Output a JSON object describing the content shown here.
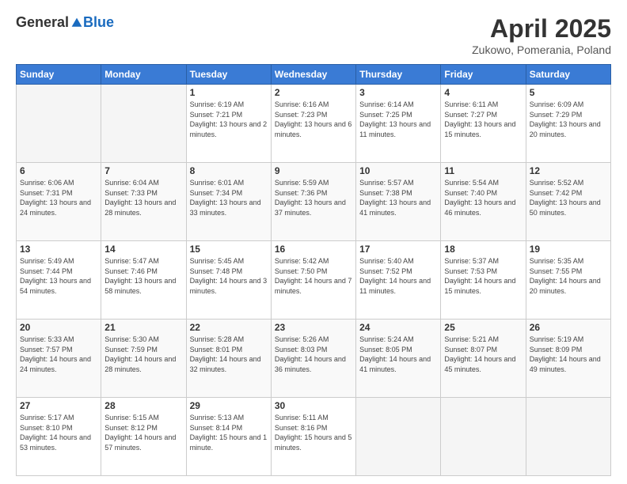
{
  "header": {
    "logo_general": "General",
    "logo_blue": "Blue",
    "month_title": "April 2025",
    "location": "Zukowo, Pomerania, Poland"
  },
  "days_of_week": [
    "Sunday",
    "Monday",
    "Tuesday",
    "Wednesday",
    "Thursday",
    "Friday",
    "Saturday"
  ],
  "weeks": [
    [
      {
        "day": "",
        "info": ""
      },
      {
        "day": "",
        "info": ""
      },
      {
        "day": "1",
        "info": "Sunrise: 6:19 AM\nSunset: 7:21 PM\nDaylight: 13 hours and 2 minutes."
      },
      {
        "day": "2",
        "info": "Sunrise: 6:16 AM\nSunset: 7:23 PM\nDaylight: 13 hours and 6 minutes."
      },
      {
        "day": "3",
        "info": "Sunrise: 6:14 AM\nSunset: 7:25 PM\nDaylight: 13 hours and 11 minutes."
      },
      {
        "day": "4",
        "info": "Sunrise: 6:11 AM\nSunset: 7:27 PM\nDaylight: 13 hours and 15 minutes."
      },
      {
        "day": "5",
        "info": "Sunrise: 6:09 AM\nSunset: 7:29 PM\nDaylight: 13 hours and 20 minutes."
      }
    ],
    [
      {
        "day": "6",
        "info": "Sunrise: 6:06 AM\nSunset: 7:31 PM\nDaylight: 13 hours and 24 minutes."
      },
      {
        "day": "7",
        "info": "Sunrise: 6:04 AM\nSunset: 7:33 PM\nDaylight: 13 hours and 28 minutes."
      },
      {
        "day": "8",
        "info": "Sunrise: 6:01 AM\nSunset: 7:34 PM\nDaylight: 13 hours and 33 minutes."
      },
      {
        "day": "9",
        "info": "Sunrise: 5:59 AM\nSunset: 7:36 PM\nDaylight: 13 hours and 37 minutes."
      },
      {
        "day": "10",
        "info": "Sunrise: 5:57 AM\nSunset: 7:38 PM\nDaylight: 13 hours and 41 minutes."
      },
      {
        "day": "11",
        "info": "Sunrise: 5:54 AM\nSunset: 7:40 PM\nDaylight: 13 hours and 46 minutes."
      },
      {
        "day": "12",
        "info": "Sunrise: 5:52 AM\nSunset: 7:42 PM\nDaylight: 13 hours and 50 minutes."
      }
    ],
    [
      {
        "day": "13",
        "info": "Sunrise: 5:49 AM\nSunset: 7:44 PM\nDaylight: 13 hours and 54 minutes."
      },
      {
        "day": "14",
        "info": "Sunrise: 5:47 AM\nSunset: 7:46 PM\nDaylight: 13 hours and 58 minutes."
      },
      {
        "day": "15",
        "info": "Sunrise: 5:45 AM\nSunset: 7:48 PM\nDaylight: 14 hours and 3 minutes."
      },
      {
        "day": "16",
        "info": "Sunrise: 5:42 AM\nSunset: 7:50 PM\nDaylight: 14 hours and 7 minutes."
      },
      {
        "day": "17",
        "info": "Sunrise: 5:40 AM\nSunset: 7:52 PM\nDaylight: 14 hours and 11 minutes."
      },
      {
        "day": "18",
        "info": "Sunrise: 5:37 AM\nSunset: 7:53 PM\nDaylight: 14 hours and 15 minutes."
      },
      {
        "day": "19",
        "info": "Sunrise: 5:35 AM\nSunset: 7:55 PM\nDaylight: 14 hours and 20 minutes."
      }
    ],
    [
      {
        "day": "20",
        "info": "Sunrise: 5:33 AM\nSunset: 7:57 PM\nDaylight: 14 hours and 24 minutes."
      },
      {
        "day": "21",
        "info": "Sunrise: 5:30 AM\nSunset: 7:59 PM\nDaylight: 14 hours and 28 minutes."
      },
      {
        "day": "22",
        "info": "Sunrise: 5:28 AM\nSunset: 8:01 PM\nDaylight: 14 hours and 32 minutes."
      },
      {
        "day": "23",
        "info": "Sunrise: 5:26 AM\nSunset: 8:03 PM\nDaylight: 14 hours and 36 minutes."
      },
      {
        "day": "24",
        "info": "Sunrise: 5:24 AM\nSunset: 8:05 PM\nDaylight: 14 hours and 41 minutes."
      },
      {
        "day": "25",
        "info": "Sunrise: 5:21 AM\nSunset: 8:07 PM\nDaylight: 14 hours and 45 minutes."
      },
      {
        "day": "26",
        "info": "Sunrise: 5:19 AM\nSunset: 8:09 PM\nDaylight: 14 hours and 49 minutes."
      }
    ],
    [
      {
        "day": "27",
        "info": "Sunrise: 5:17 AM\nSunset: 8:10 PM\nDaylight: 14 hours and 53 minutes."
      },
      {
        "day": "28",
        "info": "Sunrise: 5:15 AM\nSunset: 8:12 PM\nDaylight: 14 hours and 57 minutes."
      },
      {
        "day": "29",
        "info": "Sunrise: 5:13 AM\nSunset: 8:14 PM\nDaylight: 15 hours and 1 minute."
      },
      {
        "day": "30",
        "info": "Sunrise: 5:11 AM\nSunset: 8:16 PM\nDaylight: 15 hours and 5 minutes."
      },
      {
        "day": "",
        "info": ""
      },
      {
        "day": "",
        "info": ""
      },
      {
        "day": "",
        "info": ""
      }
    ]
  ]
}
